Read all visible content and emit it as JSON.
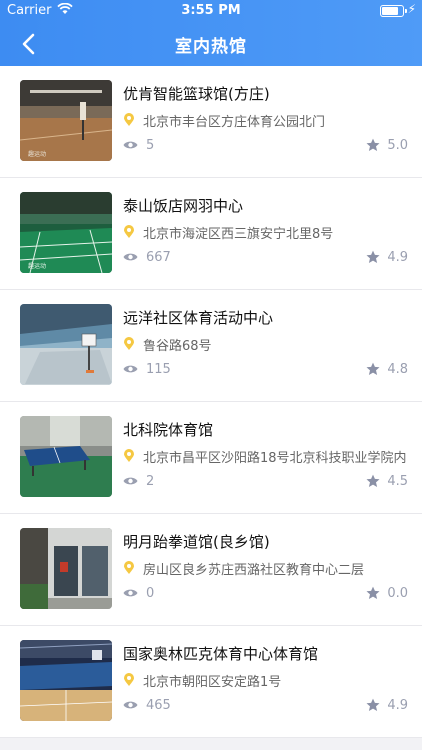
{
  "status": {
    "carrier": "Carrier",
    "time": "3:55 PM"
  },
  "header": {
    "title": "室内热馆"
  },
  "venues": [
    {
      "name": "优肯智能篮球馆(方庄)",
      "address": "北京市丰台区方庄体育公园北门",
      "views": "5",
      "rating": "5.0",
      "thumb": "basketball-indoor"
    },
    {
      "name": "泰山饭店网羽中心",
      "address": "北京市海淀区西三旗安宁北里8号",
      "views": "667",
      "rating": "4.9",
      "thumb": "badminton-court"
    },
    {
      "name": "远洋社区体育活动中心",
      "address": "鲁谷路68号",
      "views": "115",
      "rating": "4.8",
      "thumb": "basketball-court"
    },
    {
      "name": "北科院体育馆",
      "address": "北京市昌平区沙阳路18号北京科技职业学院内",
      "views": "2",
      "rating": "4.5",
      "thumb": "table-tennis"
    },
    {
      "name": "明月跆拳道馆(良乡馆)",
      "address": "房山区良乡苏庄西潞社区教育中心二层",
      "views": "0",
      "rating": "0.0",
      "thumb": "building-entrance"
    },
    {
      "name": "国家奥林匹克体育中心体育馆",
      "address": "北京市朝阳区安定路1号",
      "views": "465",
      "rating": "4.9",
      "thumb": "stadium-arena"
    }
  ],
  "colors": {
    "header": "#3d8cf2",
    "pin": "#f5c842",
    "meta": "#9a9fb0"
  }
}
